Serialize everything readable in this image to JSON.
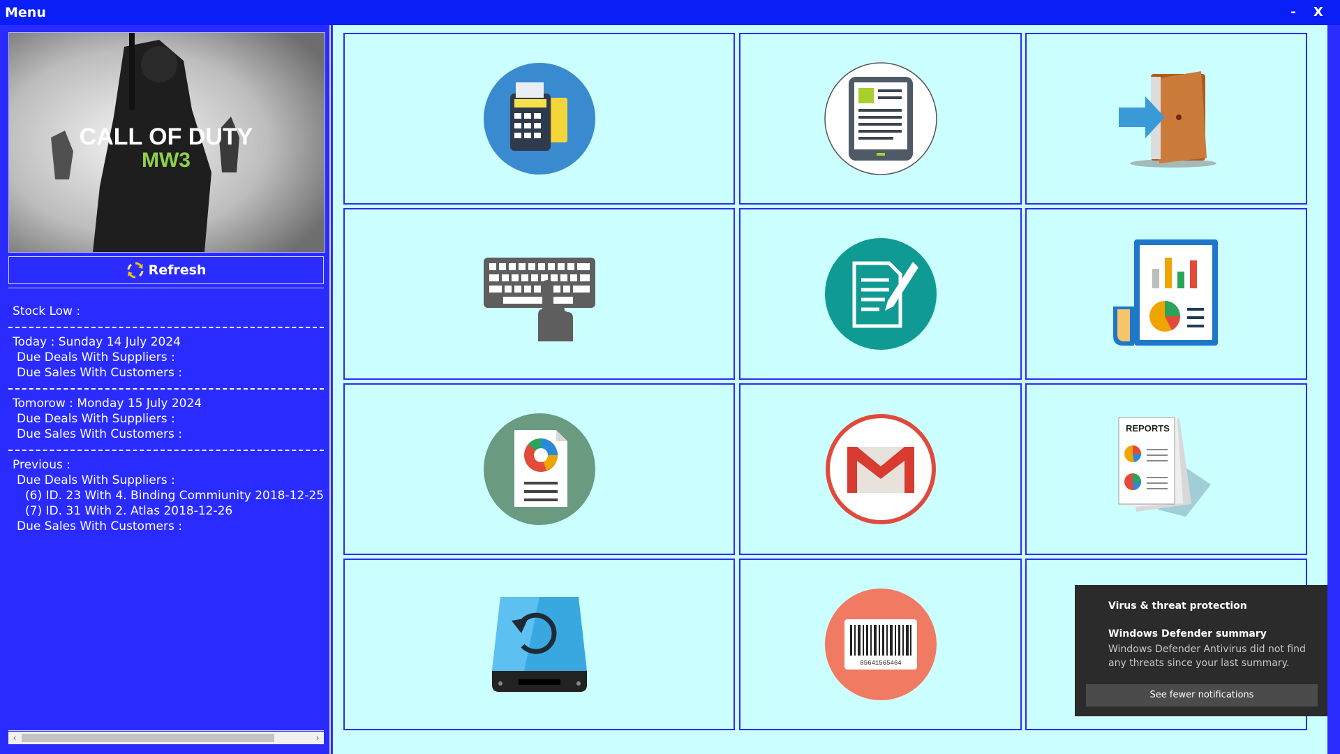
{
  "window": {
    "title": "Menu",
    "minimize_label": "-",
    "close_label": "X"
  },
  "sidebar": {
    "banner": {
      "title_line1": "CALL OF DUTY",
      "title_line2": "MW3"
    },
    "refresh_label": "Refresh",
    "stock_low_label": "Stock Low :",
    "today": {
      "label": "Today :  Sunday 14 July 2024",
      "suppliers_label": "Due Deals With Suppliers :",
      "customers_label": "Due Sales With Customers :"
    },
    "tomorrow": {
      "label": "Tomorow :     Monday 15 July 2024",
      "suppliers_label": "Due Deals With Suppliers :",
      "customers_label": "Due Sales With Customers :"
    },
    "previous": {
      "label": "Previous :",
      "suppliers_label": "Due Deals With Suppliers :",
      "deals": [
        "(6) ID. 23 With 4. Binding Commiunity    2018-12-25",
        "(7) ID. 31 With 2. Atlas    2018-12-26"
      ],
      "customers_label": "Due Sales With Customers :"
    }
  },
  "tiles": [
    {
      "icon": "cash-register-icon"
    },
    {
      "icon": "tablet-document-icon"
    },
    {
      "icon": "exit-door-icon"
    },
    {
      "icon": "keyboard-hand-icon"
    },
    {
      "icon": "document-edit-icon"
    },
    {
      "icon": "report-chart-icon"
    },
    {
      "icon": "pie-document-icon"
    },
    {
      "icon": "gmail-icon"
    },
    {
      "icon": "reports-stack-icon"
    },
    {
      "icon": "backup-drive-icon"
    },
    {
      "icon": "barcode-icon",
      "barcode_number": "85641565464"
    }
  ],
  "toast": {
    "title": "Virus & threat protection",
    "heading": "Windows Defender summary",
    "body": "Windows Defender Antivirus did not find any threats since your last summary.",
    "button": "See fewer notifications"
  },
  "colors": {
    "panel_blue": "#2a2cff",
    "titlebar_blue": "#0a1ff7",
    "tile_bg": "#ccffff",
    "tile_border": "#2b2df2",
    "toast_bg": "#2b2b2b"
  }
}
